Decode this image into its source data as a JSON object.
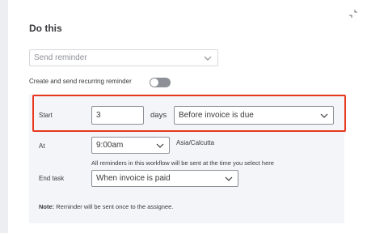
{
  "panel": {
    "title": "Do this",
    "action_select": {
      "placeholder": "Send reminder"
    },
    "recurring_label": "Create and send recurring reminder",
    "recurring_enabled": false
  },
  "start": {
    "label": "Start",
    "days_value": "3",
    "days_label": "days",
    "timing_value": "Before invoice is due"
  },
  "at": {
    "label": "At",
    "time_value": "9:00am",
    "timezone": "Asia/Calcutta",
    "hint": "All reminders in this workflow will be sent at the time you select here"
  },
  "end_task": {
    "label": "End task",
    "value": "When invoice is paid"
  },
  "note": {
    "prefix": "Note:",
    "text": "Reminder will be sent once to the assignee."
  },
  "colors": {
    "highlight": "#e8391f",
    "toggle_off": "#8d9096",
    "section_bg": "#f4f5f8"
  },
  "icons": [
    "collapse-icon",
    "chevron-down-icon"
  ]
}
